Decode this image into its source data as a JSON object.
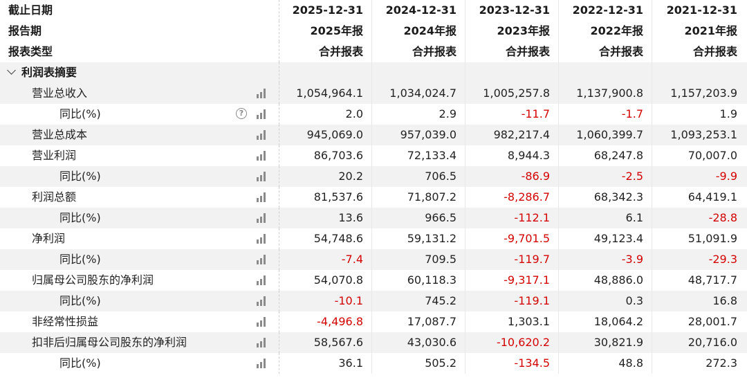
{
  "header_rows": [
    {
      "label": "截止日期",
      "values": [
        "2025-12-31",
        "2024-12-31",
        "2023-12-31",
        "2022-12-31",
        "2021-12-31"
      ]
    },
    {
      "label": "报告期",
      "values": [
        "2025年报",
        "2024年报",
        "2023年报",
        "2022年报",
        "2021年报"
      ]
    },
    {
      "label": "报表类型",
      "values": [
        "合并报表",
        "合并报表",
        "合并报表",
        "合并报表",
        "合并报表"
      ]
    }
  ],
  "section": {
    "label": "利润表摘要"
  },
  "rows": [
    {
      "label": "营业总收入",
      "level": 1,
      "values": [
        "1,054,964.1",
        "1,034,024.7",
        "1,005,257.8",
        "1,137,900.8",
        "1,157,203.9"
      ]
    },
    {
      "label": "同比(%)",
      "level": 2,
      "help": "?",
      "values": [
        "2.0",
        "2.9",
        "-11.7",
        "-1.7",
        "1.9"
      ]
    },
    {
      "label": "营业总成本",
      "level": 1,
      "values": [
        "945,069.0",
        "957,039.0",
        "982,217.4",
        "1,060,399.7",
        "1,093,253.1"
      ]
    },
    {
      "label": "营业利润",
      "level": 1,
      "values": [
        "86,703.6",
        "72,133.4",
        "8,944.3",
        "68,247.8",
        "70,007.0"
      ]
    },
    {
      "label": "同比(%)",
      "level": 2,
      "values": [
        "20.2",
        "706.5",
        "-86.9",
        "-2.5",
        "-9.9"
      ]
    },
    {
      "label": "利润总额",
      "level": 1,
      "values": [
        "81,537.6",
        "71,807.2",
        "-8,286.7",
        "68,342.3",
        "64,419.1"
      ]
    },
    {
      "label": "同比(%)",
      "level": 2,
      "values": [
        "13.6",
        "966.5",
        "-112.1",
        "6.1",
        "-28.8"
      ]
    },
    {
      "label": "净利润",
      "level": 1,
      "values": [
        "54,748.6",
        "59,131.2",
        "-9,701.5",
        "49,123.4",
        "51,091.9"
      ]
    },
    {
      "label": "同比(%)",
      "level": 2,
      "values": [
        "-7.4",
        "709.5",
        "-119.7",
        "-3.9",
        "-29.3"
      ]
    },
    {
      "label": "归属母公司股东的净利润",
      "level": 1,
      "values": [
        "54,070.8",
        "60,118.3",
        "-9,317.1",
        "48,886.0",
        "48,717.7"
      ]
    },
    {
      "label": "同比(%)",
      "level": 2,
      "values": [
        "-10.1",
        "745.2",
        "-119.1",
        "0.3",
        "16.8"
      ]
    },
    {
      "label": "非经常性损益",
      "level": 1,
      "values": [
        "-4,496.8",
        "17,087.7",
        "1,303.1",
        "18,064.2",
        "28,001.7"
      ]
    },
    {
      "label": "扣非后归属母公司股东的净利润",
      "level": 1,
      "values": [
        "58,567.6",
        "43,030.6",
        "-10,620.2",
        "30,821.9",
        "20,716.0"
      ]
    },
    {
      "label": "同比(%)",
      "level": 2,
      "values": [
        "36.1",
        "505.2",
        "-134.5",
        "48.8",
        "272.3"
      ]
    }
  ],
  "icons": {
    "chart": "bar-chart-icon",
    "help": "question-circle-icon",
    "toggle": "chevron-down-icon"
  },
  "colors": {
    "negative": "#d40000",
    "shade": "#f2f2f2",
    "text": "#222222"
  }
}
